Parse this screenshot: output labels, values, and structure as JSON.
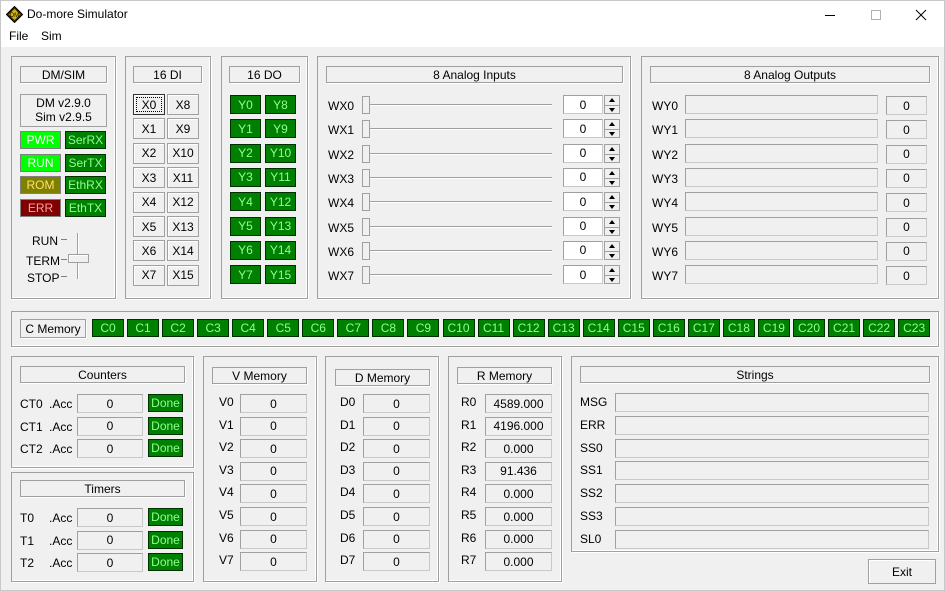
{
  "window": {
    "title": "Do-more Simulator"
  },
  "menu": [
    "File",
    "Sim"
  ],
  "dmsim": {
    "header": "DM/SIM",
    "dm_version": "DM v2.9.0",
    "sim_version": "Sim v2.9.5",
    "leds": [
      {
        "label": "PWR",
        "style": "on"
      },
      {
        "label": "SerRX",
        "style": "dk"
      },
      {
        "label": "RUN",
        "style": "on"
      },
      {
        "label": "SerTX",
        "style": "dk"
      },
      {
        "label": "ROM",
        "style": "olive"
      },
      {
        "label": "EthRX",
        "style": "dk"
      },
      {
        "label": "ERR",
        "style": "maroon"
      },
      {
        "label": "EthTX",
        "style": "dk"
      }
    ],
    "mode_labels": [
      "RUN",
      "TERM",
      "STOP"
    ]
  },
  "di": {
    "header": "16 DI",
    "items": [
      "X0",
      "X1",
      "X2",
      "X3",
      "X4",
      "X5",
      "X6",
      "X7",
      "X8",
      "X9",
      "X10",
      "X11",
      "X12",
      "X13",
      "X14",
      "X15"
    ]
  },
  "do": {
    "header": "16 DO",
    "items": [
      "Y0",
      "Y1",
      "Y2",
      "Y3",
      "Y4",
      "Y5",
      "Y6",
      "Y7",
      "Y8",
      "Y9",
      "Y10",
      "Y11",
      "Y12",
      "Y13",
      "Y14",
      "Y15"
    ]
  },
  "analog_in": {
    "header": "8 Analog Inputs",
    "items": [
      {
        "label": "WX0",
        "value": "0"
      },
      {
        "label": "WX1",
        "value": "0"
      },
      {
        "label": "WX2",
        "value": "0"
      },
      {
        "label": "WX3",
        "value": "0"
      },
      {
        "label": "WX4",
        "value": "0"
      },
      {
        "label": "WX5",
        "value": "0"
      },
      {
        "label": "WX6",
        "value": "0"
      },
      {
        "label": "WX7",
        "value": "0"
      }
    ]
  },
  "analog_out": {
    "header": "8 Analog Outputs",
    "items": [
      {
        "label": "WY0",
        "value": "0"
      },
      {
        "label": "WY1",
        "value": "0"
      },
      {
        "label": "WY2",
        "value": "0"
      },
      {
        "label": "WY3",
        "value": "0"
      },
      {
        "label": "WY4",
        "value": "0"
      },
      {
        "label": "WY5",
        "value": "0"
      },
      {
        "label": "WY6",
        "value": "0"
      },
      {
        "label": "WY7",
        "value": "0"
      }
    ]
  },
  "cmem": {
    "header": "C Memory",
    "items": [
      "C0",
      "C1",
      "C2",
      "C3",
      "C4",
      "C5",
      "C6",
      "C7",
      "C8",
      "C9",
      "C10",
      "C11",
      "C12",
      "C13",
      "C14",
      "C15",
      "C16",
      "C17",
      "C18",
      "C19",
      "C20",
      "C21",
      "C22",
      "C23"
    ]
  },
  "counters": {
    "header": "Counters",
    "items": [
      {
        "label": "CT0",
        "acc": ".Acc",
        "value": "0",
        "done": "Done"
      },
      {
        "label": "CT1",
        "acc": ".Acc",
        "value": "0",
        "done": "Done"
      },
      {
        "label": "CT2",
        "acc": ".Acc",
        "value": "0",
        "done": "Done"
      }
    ]
  },
  "timers": {
    "header": "Timers",
    "items": [
      {
        "label": "T0",
        "acc": ".Acc",
        "value": "0",
        "done": "Done"
      },
      {
        "label": "T1",
        "acc": ".Acc",
        "value": "0",
        "done": "Done"
      },
      {
        "label": "T2",
        "acc": ".Acc",
        "value": "0",
        "done": "Done"
      }
    ]
  },
  "vmem": {
    "header": "V Memory",
    "items": [
      {
        "label": "V0",
        "value": "0"
      },
      {
        "label": "V1",
        "value": "0"
      },
      {
        "label": "V2",
        "value": "0"
      },
      {
        "label": "V3",
        "value": "0"
      },
      {
        "label": "V4",
        "value": "0"
      },
      {
        "label": "V5",
        "value": "0"
      },
      {
        "label": "V6",
        "value": "0"
      },
      {
        "label": "V7",
        "value": "0"
      }
    ]
  },
  "dmem": {
    "header": "D Memory",
    "items": [
      {
        "label": "D0",
        "value": "0"
      },
      {
        "label": "D1",
        "value": "0"
      },
      {
        "label": "D2",
        "value": "0"
      },
      {
        "label": "D3",
        "value": "0"
      },
      {
        "label": "D4",
        "value": "0"
      },
      {
        "label": "D5",
        "value": "0"
      },
      {
        "label": "D6",
        "value": "0"
      },
      {
        "label": "D7",
        "value": "0"
      }
    ]
  },
  "rmem": {
    "header": "R Memory",
    "items": [
      {
        "label": "R0",
        "value": "4589.000"
      },
      {
        "label": "R1",
        "value": "4196.000"
      },
      {
        "label": "R2",
        "value": "0.000"
      },
      {
        "label": "R3",
        "value": "91.436"
      },
      {
        "label": "R4",
        "value": "0.000"
      },
      {
        "label": "R5",
        "value": "0.000"
      },
      {
        "label": "R6",
        "value": "0.000"
      },
      {
        "label": "R7",
        "value": "0.000"
      }
    ]
  },
  "strings": {
    "header": "Strings",
    "items": [
      {
        "label": "MSG",
        "value": ""
      },
      {
        "label": "ERR",
        "value": ""
      },
      {
        "label": "SS0",
        "value": ""
      },
      {
        "label": "SS1",
        "value": ""
      },
      {
        "label": "SS2",
        "value": ""
      },
      {
        "label": "SS3",
        "value": ""
      },
      {
        "label": "SL0",
        "value": ""
      }
    ]
  },
  "exit_label": "Exit"
}
